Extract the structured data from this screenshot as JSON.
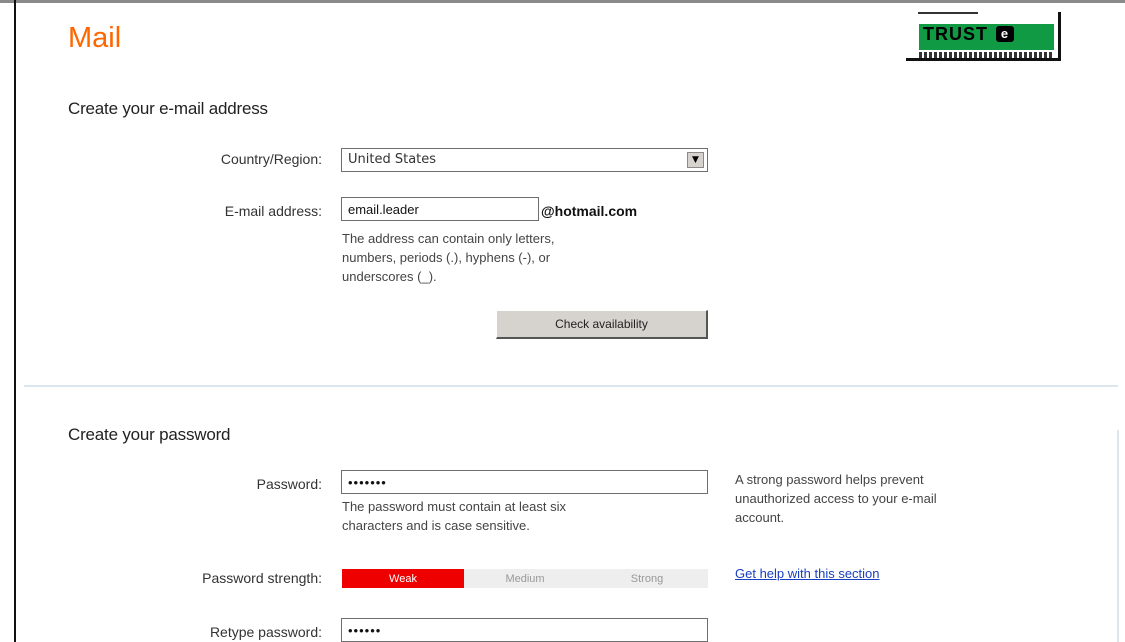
{
  "app": {
    "title": "Mail"
  },
  "badge": {
    "text": "TRUST",
    "mark": "e",
    "color": "#0f9a43"
  },
  "email_section": {
    "heading": "Create your e-mail address",
    "country_label": "Country/Region:",
    "country_value": "United States",
    "email_label": "E-mail address:",
    "email_value": "email.leader",
    "domain": "@hotmail.com",
    "hint_lines": [
      "The address can contain only letters,",
      "numbers, periods (.), hyphens (-), or",
      "underscores (_)."
    ],
    "check_button": "Check availability"
  },
  "password_section": {
    "heading": "Create your password",
    "password_label": "Password:",
    "password_value": "•••••••",
    "password_hint_lines": [
      "The password must contain at least six",
      "characters and is case sensitive."
    ],
    "side_note_lines": [
      "A strong password helps prevent",
      "unauthorized access to your e-mail",
      "account."
    ],
    "help_link": "Get help with this section",
    "strength_label": "Password strength:",
    "strength": {
      "weak": "Weak",
      "medium": "Medium",
      "strong": "Strong",
      "level": "weak"
    },
    "retype_label": "Retype password:",
    "retype_value": "••••••"
  },
  "colors": {
    "brand": "#ff6600",
    "link": "#1a3fbf",
    "weak": "#ee0000"
  }
}
